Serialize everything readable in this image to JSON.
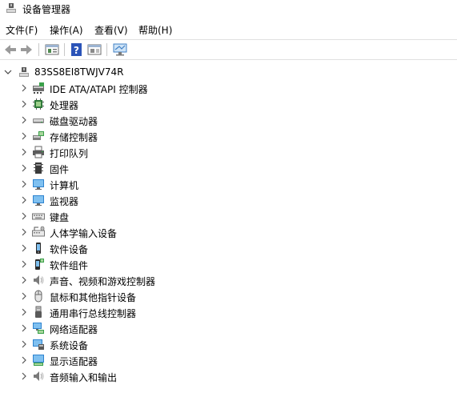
{
  "window": {
    "title": "设备管理器"
  },
  "menu": [
    {
      "label": "文件(F)"
    },
    {
      "label": "操作(A)"
    },
    {
      "label": "查看(V)"
    },
    {
      "label": "帮助(H)"
    }
  ],
  "toolbar": {
    "buttons": [
      "back-icon",
      "forward-icon",
      "properties-icon",
      "help-icon",
      "show-hidden-icon",
      "scan-hardware-icon"
    ]
  },
  "tree": {
    "root": {
      "label": "83SS8EI8TWJV74R",
      "icon": "computer-icon",
      "expanded": true
    },
    "items": [
      {
        "label": "IDE ATA/ATAPI 控制器",
        "icon": "ide-controller-icon"
      },
      {
        "label": "处理器",
        "icon": "processor-icon"
      },
      {
        "label": "磁盘驱动器",
        "icon": "disk-drive-icon"
      },
      {
        "label": "存储控制器",
        "icon": "storage-controller-icon"
      },
      {
        "label": "打印队列",
        "icon": "printer-icon"
      },
      {
        "label": "固件",
        "icon": "firmware-icon"
      },
      {
        "label": "计算机",
        "icon": "monitor-icon"
      },
      {
        "label": "监视器",
        "icon": "monitor-icon"
      },
      {
        "label": "键盘",
        "icon": "keyboard-icon"
      },
      {
        "label": "人体学输入设备",
        "icon": "hid-icon"
      },
      {
        "label": "软件设备",
        "icon": "software-device-icon"
      },
      {
        "label": "软件组件",
        "icon": "software-component-icon"
      },
      {
        "label": "声音、视频和游戏控制器",
        "icon": "speaker-icon"
      },
      {
        "label": "鼠标和其他指针设备",
        "icon": "mouse-icon"
      },
      {
        "label": "通用串行总线控制器",
        "icon": "usb-icon"
      },
      {
        "label": "网络适配器",
        "icon": "network-icon"
      },
      {
        "label": "系统设备",
        "icon": "system-device-icon"
      },
      {
        "label": "显示适配器",
        "icon": "display-adapter-icon"
      },
      {
        "label": "音频输入和输出",
        "icon": "speaker-icon"
      }
    ]
  }
}
